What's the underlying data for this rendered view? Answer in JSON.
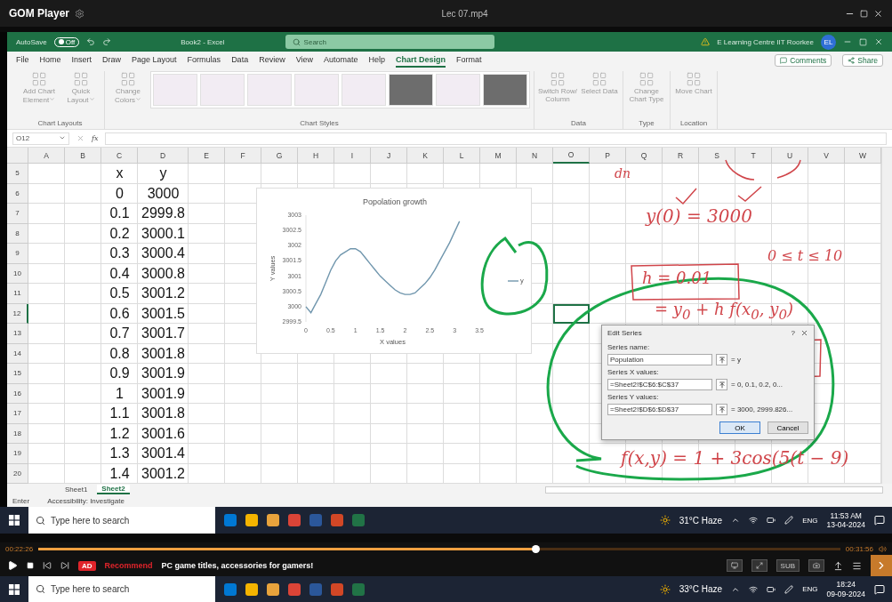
{
  "player": {
    "title": "GOM Player",
    "file": "Lec 07.mp4",
    "elapsed": "00:22:26",
    "total": "00:31:56",
    "progress": {
      "level": 0.62
    },
    "ad_badge": "AD",
    "ad_label": "Recommend",
    "ad_text": "PC game titles, accessories for gamers!",
    "subtitle_button": "SUB"
  },
  "excel": {
    "autosave": {
      "label": "AutoSave",
      "state": "Off",
      "on": false
    },
    "title": "Book2 - Excel",
    "search_placeholder": "Search",
    "warning": "E Learning Centre IIT Roorkee",
    "avatar": "EL",
    "tabs": [
      {
        "label": "File",
        "selected": false
      },
      {
        "label": "Home",
        "selected": false
      },
      {
        "label": "Insert",
        "selected": false
      },
      {
        "label": "Draw",
        "selected": false
      },
      {
        "label": "Page Layout",
        "selected": false
      },
      {
        "label": "Formulas",
        "selected": false
      },
      {
        "label": "Data",
        "selected": false
      },
      {
        "label": "Review",
        "selected": false
      },
      {
        "label": "View",
        "selected": false
      },
      {
        "label": "Automate",
        "selected": false
      },
      {
        "label": "Help",
        "selected": false
      },
      {
        "label": "Chart Design",
        "selected": true
      },
      {
        "label": "Format",
        "selected": false
      }
    ],
    "share_buttons": [
      "Comments",
      "Share"
    ],
    "ribbon_groups": [
      {
        "label": "Chart Layouts",
        "commands": [
          {
            "label": "Add Chart Element",
            "dropdown": true
          },
          {
            "label": "Quick Layout",
            "dropdown": true
          }
        ]
      },
      {
        "label": "Chart Styles",
        "commands": [
          {
            "label": "Change Colors",
            "dropdown": true
          }
        ],
        "styles": [
          {
            "kind": "light"
          },
          {
            "kind": "light"
          },
          {
            "kind": "light"
          },
          {
            "kind": "light"
          },
          {
            "kind": "light"
          },
          {
            "kind": "dark"
          },
          {
            "kind": "light"
          },
          {
            "kind": "dark"
          }
        ]
      },
      {
        "label": "Data",
        "commands": [
          {
            "label": "Switch Row/ Column",
            "dropdown": false
          },
          {
            "label": "Select Data",
            "dropdown": false
          }
        ]
      },
      {
        "label": "Type",
        "commands": [
          {
            "label": "Change Chart Type",
            "dropdown": false
          }
        ]
      },
      {
        "label": "Location",
        "commands": [
          {
            "label": "Move Chart",
            "dropdown": false
          }
        ]
      }
    ],
    "name_box": "O12",
    "formula_label": "fx",
    "columns": [
      {
        "label": "A",
        "selected": false
      },
      {
        "label": "B",
        "selected": false
      },
      {
        "label": "C",
        "selected": false
      },
      {
        "label": "D",
        "selected": false
      },
      {
        "label": "E",
        "selected": false
      },
      {
        "label": "F",
        "selected": false
      },
      {
        "label": "G",
        "selected": false
      },
      {
        "label": "H",
        "selected": false
      },
      {
        "label": "I",
        "selected": false
      },
      {
        "label": "J",
        "selected": false
      },
      {
        "label": "K",
        "selected": false
      },
      {
        "label": "L",
        "selected": false
      },
      {
        "label": "M",
        "selected": false
      },
      {
        "label": "N",
        "selected": false
      },
      {
        "label": "O",
        "selected": true
      },
      {
        "label": "P",
        "selected": false
      },
      {
        "label": "Q",
        "selected": false
      },
      {
        "label": "R",
        "selected": false
      },
      {
        "label": "S",
        "selected": false
      },
      {
        "label": "T",
        "selected": false
      },
      {
        "label": "U",
        "selected": false
      },
      {
        "label": "V",
        "selected": false
      },
      {
        "label": "W",
        "selected": false
      }
    ],
    "rows": [
      {
        "number": "5",
        "selected": false,
        "c": "x",
        "d": "y"
      },
      {
        "number": "6",
        "selected": false,
        "c": "0",
        "d": "3000"
      },
      {
        "number": "7",
        "selected": false,
        "c": "0.1",
        "d": "2999.8"
      },
      {
        "number": "8",
        "selected": false,
        "c": "0.2",
        "d": "3000.1"
      },
      {
        "number": "9",
        "selected": false,
        "c": "0.3",
        "d": "3000.4"
      },
      {
        "number": "10",
        "selected": false,
        "c": "0.4",
        "d": "3000.8"
      },
      {
        "number": "11",
        "selected": false,
        "c": "0.5",
        "d": "3001.2"
      },
      {
        "number": "12",
        "selected": true,
        "c": "0.6",
        "d": "3001.5"
      },
      {
        "number": "13",
        "selected": false,
        "c": "0.7",
        "d": "3001.7"
      },
      {
        "number": "14",
        "selected": false,
        "c": "0.8",
        "d": "3001.8"
      },
      {
        "number": "15",
        "selected": false,
        "c": "0.9",
        "d": "3001.9"
      },
      {
        "number": "16",
        "selected": false,
        "c": "1",
        "d": "3001.9"
      },
      {
        "number": "17",
        "selected": false,
        "c": "1.1",
        "d": "3001.8"
      },
      {
        "number": "18",
        "selected": false,
        "c": "1.2",
        "d": "3001.6"
      },
      {
        "number": "19",
        "selected": false,
        "c": "1.3",
        "d": "3001.4"
      },
      {
        "number": "20",
        "selected": false,
        "c": "1.4",
        "d": "3001.2"
      }
    ],
    "sheets": [
      {
        "label": "Sheet1",
        "selected": false
      },
      {
        "label": "Sheet2",
        "selected": true
      }
    ],
    "status": [
      "Enter",
      "Accessibility: Investigate"
    ],
    "chart": {
      "chart_data": {
        "type": "line",
        "title": "Popolation growth",
        "xlabel": "X values",
        "ylabel": "Y values",
        "x": [
          0,
          0.1,
          0.2,
          0.3,
          0.4,
          0.5,
          0.6,
          0.7,
          0.8,
          0.9,
          1,
          1.1,
          1.2,
          1.3,
          1.4,
          1.5,
          1.6,
          1.7,
          1.8,
          1.9,
          2,
          2.1,
          2.2,
          2.3,
          2.4,
          2.5,
          2.6,
          2.7,
          2.8,
          2.9,
          3,
          3.1
        ],
        "series": [
          {
            "name": "y",
            "color": "#7096ad",
            "values": [
              3000,
              2999.8,
              3000.1,
              3000.4,
              3000.8,
              3001.2,
              3001.5,
              3001.7,
              3001.8,
              3001.9,
              3001.9,
              3001.8,
              3001.6,
              3001.4,
              3001.2,
              3001.0,
              3000.85,
              3000.7,
              3000.55,
              3000.45,
              3000.4,
              3000.4,
              3000.45,
              3000.6,
              3000.75,
              3000.95,
              3001.2,
              3001.5,
              3001.8,
              3002.1,
              3002.45,
              3002.8
            ]
          }
        ],
        "xlim": [
          0,
          3.5
        ],
        "ylim": [
          2999.5,
          3003
        ],
        "xticks": [
          0,
          0.5,
          1,
          1.5,
          2,
          2.5,
          3,
          3.5
        ],
        "yticks": [
          2999.5,
          3000,
          3000.5,
          3001,
          3001.5,
          3002,
          3002.5,
          3003
        ]
      }
    },
    "dialog": {
      "title": "Edit Series",
      "help": "?",
      "fields": [
        {
          "label": "Series name:",
          "value": "Population",
          "preview": "= y"
        },
        {
          "label": "Series X values:",
          "value": "=Sheet2!$C$6:$C$37",
          "preview": "= 0, 0.1, 0.2, 0..."
        },
        {
          "label": "Series Y values:",
          "value": "=Sheet2!$D$6:$D$37",
          "preview": "= 3000, 2999.826..."
        }
      ],
      "buttons": [
        {
          "label": "OK",
          "selected": true
        },
        {
          "label": "Cancel",
          "selected": false
        }
      ]
    }
  },
  "annotations": [
    {
      "text": "dn"
    },
    {
      "text": "y(0) = 3000"
    },
    {
      "text": "0 ≤ t ≤ 10"
    },
    {
      "text": "h = 0.01"
    },
    {
      "text": "= y$_{0}$ + h f(x$_{0}$, y$_{0}$)"
    },
    {
      "text": "f(x,y) = 1 + 3cos(5(t − 9)"
    }
  ],
  "inner_taskbar": {
    "search_placeholder": "Type here to search",
    "weather": "31°C Haze",
    "language": "ENG",
    "time": "11:53 AM",
    "date": "13-04-2024"
  },
  "outer_taskbar": {
    "search_placeholder": "Type here to search",
    "weather": "33°C Haze",
    "language": "ENG",
    "time": "18:24",
    "date": "09-09-2024"
  }
}
